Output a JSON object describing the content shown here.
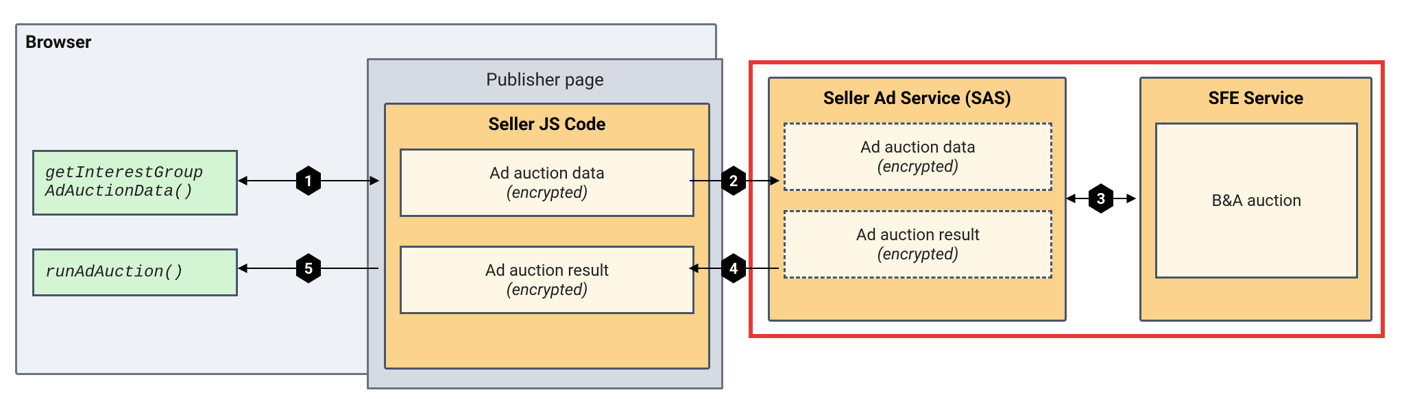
{
  "browser": {
    "label": "Browser"
  },
  "publisher": {
    "label": "Publisher page"
  },
  "seller_js": {
    "title": "Seller JS Code"
  },
  "api": {
    "get_interest_group_line1": "getInterestGroup",
    "get_interest_group_line2": "AdAuctionData()",
    "run_ad_auction": "runAdAuction()"
  },
  "payload": {
    "data_label": "Ad auction data",
    "result_label": "Ad auction result",
    "encrypted": "(encrypted)"
  },
  "sas": {
    "title": "Seller Ad Service (SAS)"
  },
  "sfe": {
    "title": "SFE Service",
    "content": "B&A auction"
  },
  "steps": {
    "s1": "1",
    "s2": "2",
    "s3": "3",
    "s4": "4",
    "s5": "5"
  }
}
